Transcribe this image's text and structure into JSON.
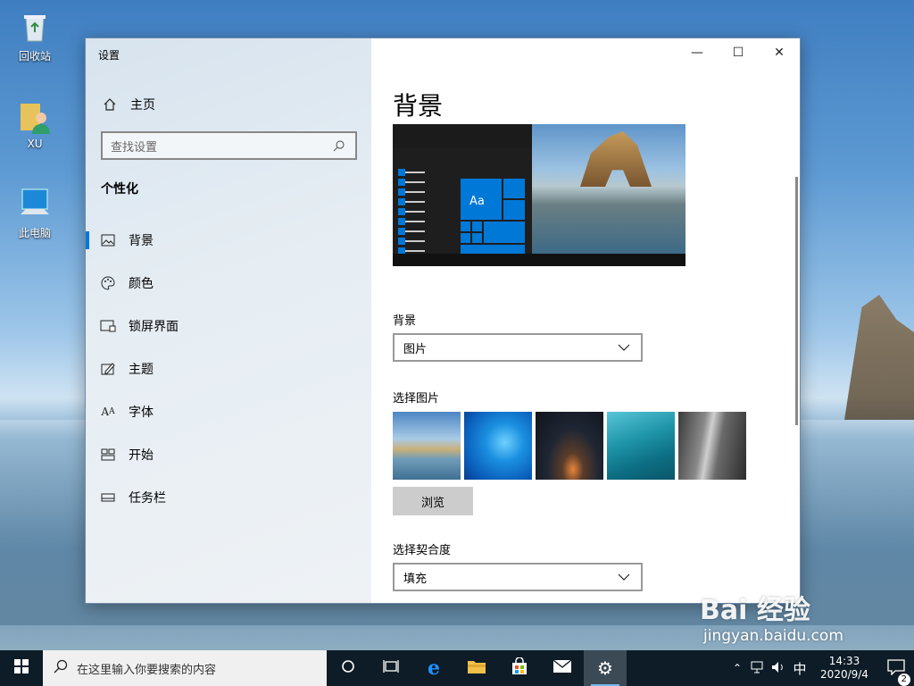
{
  "desktop": {
    "icons": [
      {
        "label": "回收站"
      },
      {
        "label": "XU"
      },
      {
        "label": "此电脑"
      }
    ]
  },
  "window": {
    "title": "设置",
    "controls": {
      "minimize": "—",
      "maximize": "☐",
      "close": "✕"
    }
  },
  "nav": {
    "home_label": "主页",
    "search_placeholder": "查找设置",
    "section_title": "个性化",
    "items": [
      {
        "label": "背景",
        "icon": "image-icon",
        "active": true
      },
      {
        "label": "颜色",
        "icon": "palette-icon"
      },
      {
        "label": "锁屏界面",
        "icon": "lock-screen-icon"
      },
      {
        "label": "主题",
        "icon": "theme-icon"
      },
      {
        "label": "字体",
        "icon": "font-icon"
      },
      {
        "label": "开始",
        "icon": "start-icon"
      },
      {
        "label": "任务栏",
        "icon": "taskbar-icon"
      }
    ]
  },
  "content": {
    "page_title": "背景",
    "preview_tile_text": "Aa",
    "background_label": "背景",
    "background_value": "图片",
    "choose_picture_label": "选择图片",
    "browse_label": "浏览",
    "fit_label": "选择契合度",
    "fit_value": "填充"
  },
  "taskbar": {
    "search_placeholder": "在这里输入你要搜索的内容",
    "ime": "中",
    "time": "14:33",
    "date": "2020/9/4",
    "notification_count": "2"
  },
  "watermark": {
    "brand": "Bai 经验",
    "url": "jingyan.baidu.com"
  },
  "colors": {
    "accent": "#0078d7",
    "taskbar": "#0d1c26"
  }
}
